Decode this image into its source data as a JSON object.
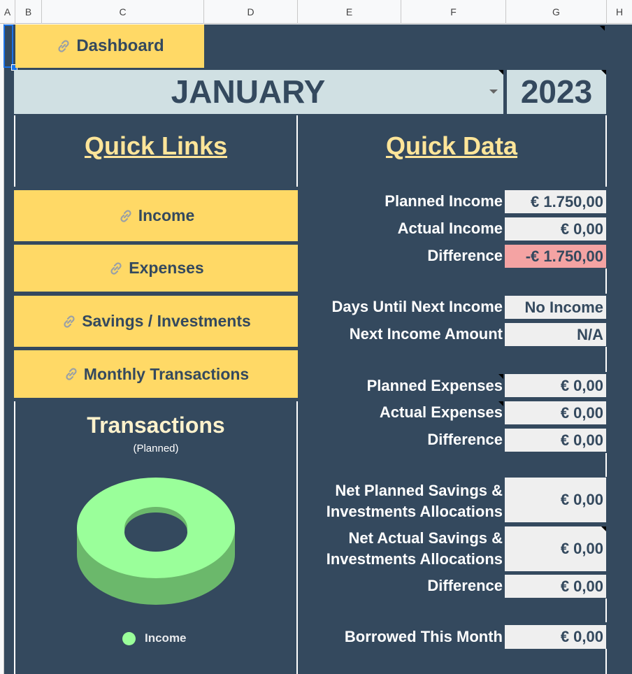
{
  "columns": [
    "A",
    "B",
    "C",
    "D",
    "E",
    "F",
    "G",
    "H"
  ],
  "dashboard_label": "Dashboard",
  "month": "JANUARY",
  "year": "2023",
  "quick_links": {
    "title": "Quick Links",
    "items": [
      "Income",
      "Expenses",
      "Savings / Investments",
      "Monthly Transactions"
    ]
  },
  "quick_data": {
    "title": "Quick Data",
    "planned_income": {
      "label": "Planned Income",
      "value": "€ 1.750,00"
    },
    "actual_income": {
      "label": "Actual Income",
      "value": "€ 0,00"
    },
    "income_difference": {
      "label": "Difference",
      "value": "-€ 1.750,00"
    },
    "days_until_next_income": {
      "label": "Days Until Next Income",
      "value": "No Income"
    },
    "next_income_amount": {
      "label": "Next Income Amount",
      "value": "N/A"
    },
    "planned_expenses": {
      "label": "Planned Expenses",
      "value": "€ 0,00"
    },
    "actual_expenses": {
      "label": "Actual Expenses",
      "value": "€ 0,00"
    },
    "expenses_difference": {
      "label": "Difference",
      "value": "€ 0,00"
    },
    "net_planned_savings": {
      "label_line1": "Net Planned Savings &",
      "label_line2": "Investments Allocations",
      "value": "€ 0,00"
    },
    "net_actual_savings": {
      "label_line1": "Net Actual Savings &",
      "label_line2": "Investments Allocations",
      "value": "€ 0,00"
    },
    "savings_difference": {
      "label": "Difference",
      "value": "€ 0,00"
    },
    "borrowed": {
      "label": "Borrowed This Month",
      "value": "€ 0,00"
    }
  },
  "colors": {
    "background": "#34495e",
    "button": "#ffd966",
    "header_text": "#ffe599",
    "value_cell": "#efefef",
    "negative_cell": "#f4a3a3",
    "chart_slice": "#9aff9a"
  },
  "icons": {
    "link": "link-icon",
    "dropdown": "chevron-down-icon"
  },
  "chart_data": {
    "type": "pie",
    "title": "Transactions",
    "subtitle": "(Planned)",
    "legend_position": "bottom",
    "series": [
      {
        "name": "Income",
        "values": [
          1
        ]
      }
    ],
    "categories": [
      "Income"
    ]
  }
}
